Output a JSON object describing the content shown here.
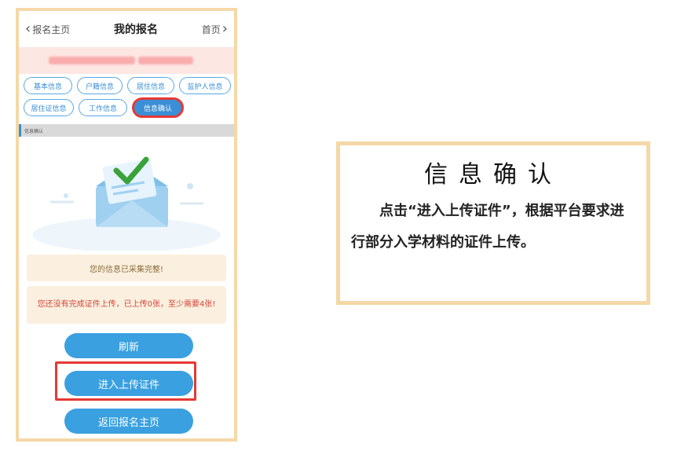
{
  "header": {
    "back_label": "报名主页",
    "title": "我的报名",
    "home_label": "首页"
  },
  "tabs": [
    {
      "label": "基本信息"
    },
    {
      "label": "户籍信息"
    },
    {
      "label": "居住信息"
    },
    {
      "label": "监护人信息"
    },
    {
      "label": "居住证信息"
    },
    {
      "label": "工作信息"
    },
    {
      "label": "信息确认",
      "active": true
    }
  ],
  "section": {
    "title": "信息确认"
  },
  "notices": {
    "complete": "您的信息已采集完整!",
    "warning": "您还没有完成证件上传，已上传0张，至少需要4张!"
  },
  "buttons": {
    "refresh": "刷新",
    "upload": "进入上传证件",
    "back": "返回报名主页"
  },
  "panel": {
    "title": "信息确认",
    "body": "点击“进入上传证件”，根据平台要求进行部分入学材料的证件上传。"
  },
  "colors": {
    "accent": "#3aa0e0",
    "highlight": "#e53935",
    "frame": "#f4d8a6"
  }
}
